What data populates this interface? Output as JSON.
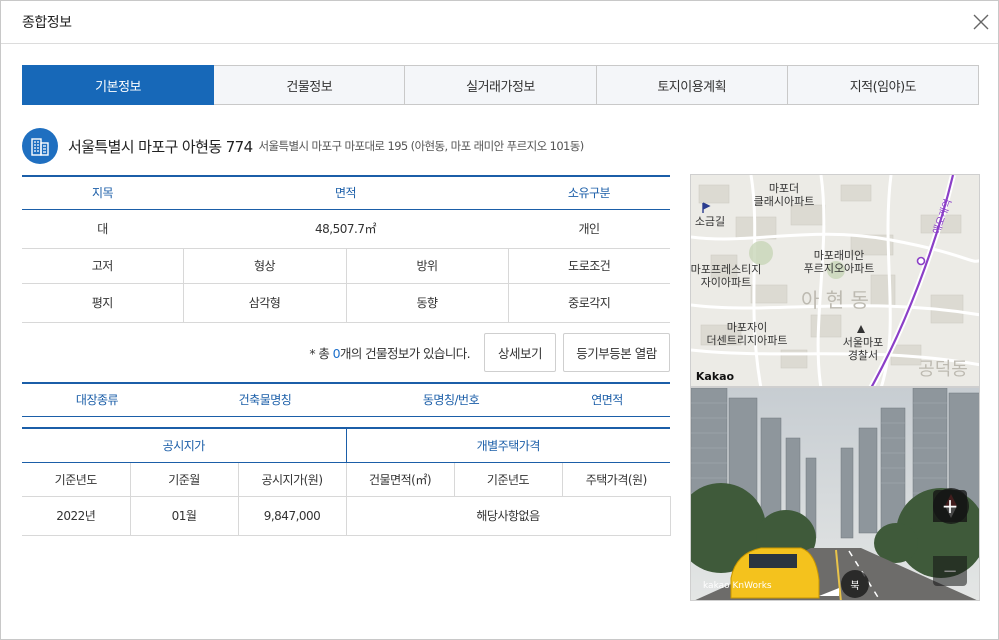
{
  "modal": {
    "title": "종합정보"
  },
  "tabs": [
    {
      "label": "기본정보",
      "active": true
    },
    {
      "label": "건물정보",
      "active": false
    },
    {
      "label": "실거래가정보",
      "active": false
    },
    {
      "label": "토지이용계획",
      "active": false
    },
    {
      "label": "지적(임야)도",
      "active": false
    }
  ],
  "address": {
    "main": "서울특별시 마포구 아현동 774",
    "sub": "서울특별시 마포구 마포대로 195 (아현동, 마포 래미안 푸르지오 101동)"
  },
  "land_table": {
    "headers": [
      "지목",
      "면적",
      "소유구분"
    ],
    "values": [
      "대",
      "48,507.7㎡",
      "개인"
    ],
    "headers2": [
      "고저",
      "형상",
      "방위",
      "도로조건"
    ],
    "values2": [
      "평지",
      "삼각형",
      "동향",
      "중로각지"
    ]
  },
  "building_info": {
    "prefix": "* 총 ",
    "count": "0",
    "suffix": "개의 건물정보가 있습니다.",
    "detail_button": "상세보기",
    "registry_button": "등기부등본 열람"
  },
  "building_table": {
    "headers": [
      "대장종류",
      "건축물명칭",
      "동명칭/번호",
      "연면적"
    ]
  },
  "price_table": {
    "group1": "공시지가",
    "group2": "개별주택가격",
    "headers": [
      "기준년도",
      "기준월",
      "공시지가(원)",
      "건물면적(㎡)",
      "기준년도",
      "주택가격(원)"
    ],
    "values": [
      "2022년",
      "01월",
      "9,847,000"
    ],
    "no_data": "해당사항없음"
  },
  "map": {
    "labels": {
      "l1": "마포더",
      "l2": "클래시아파트",
      "l3": "소금길",
      "l4": "마포래미안",
      "l5": "푸르지오아파트",
      "l6": "마포프레스티지",
      "l7": "자이아파트",
      "l8": "아 현 동",
      "l9": "마포자이",
      "l10": "더센트리지아파트",
      "l11": "서울마포",
      "l12": "경찰서",
      "l13": "애오개역",
      "l14": "공덕동",
      "l15": "Kakao"
    }
  },
  "roadview": {
    "watermark": "kakao KnWorks",
    "compass_label": "북",
    "zoom_in": "+",
    "zoom_out": "−"
  },
  "colors": {
    "accent": "#1768b8",
    "header_text": "#1b5ea8",
    "count": "#1b6fcb"
  }
}
